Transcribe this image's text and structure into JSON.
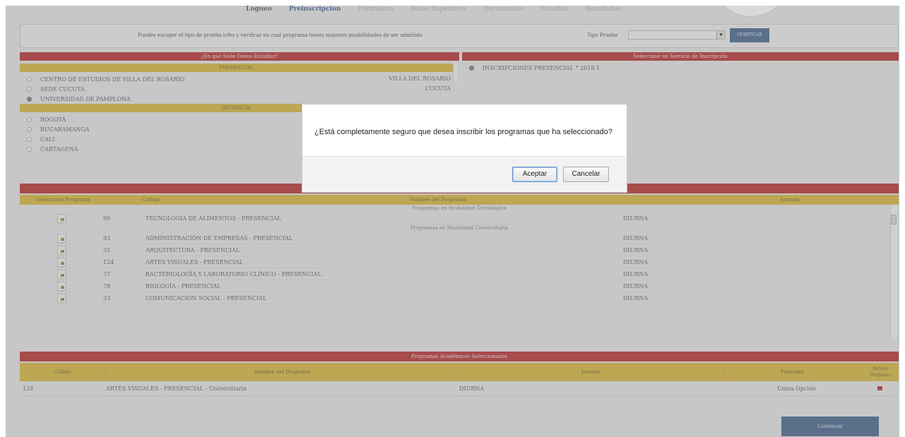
{
  "nav": {
    "tabs": [
      {
        "label": "Logueo",
        "state": "dark"
      },
      {
        "label": "Preinscripcion",
        "state": "active"
      },
      {
        "label": "Formulario",
        "state": "muted"
      },
      {
        "label": "Datos Superiores",
        "state": "muted"
      },
      {
        "label": "Documentos",
        "state": "muted"
      },
      {
        "label": "Estudios",
        "state": "muted"
      },
      {
        "label": "Resultados",
        "state": "muted"
      }
    ]
  },
  "instruction": {
    "text": "Puedes escoger el tipo de prueba icfes y verificar en cual programa tienes mayores posibilidades de ser admitido",
    "tipo_label": "Tipo Prueba",
    "tipo_value": "",
    "verify_label": "VERIFICAR"
  },
  "study_place": {
    "title": "¿En qué Sede Desea Estudiar?",
    "presencial_label": "PRESENCIAL",
    "presencial": [
      {
        "name": "CENTRO DE ESTUDIOS DE VILLA DEL ROSARIO",
        "city": "VILLA DEL ROSARIO",
        "selected": false
      },
      {
        "name": "SEDE CUCUTA",
        "city": "CUCUTA",
        "selected": false
      },
      {
        "name": "UNIVERSIDAD DE PAMPLONA",
        "city": "",
        "selected": true
      }
    ],
    "distancia_label": "DISTANCIA",
    "distancia": [
      {
        "name": "BOGOTÁ",
        "selected": false
      },
      {
        "name": "BUCARAMANGA",
        "selected": false
      },
      {
        "name": "CALI",
        "selected": false
      },
      {
        "name": "CARTAGENA",
        "selected": false
      }
    ]
  },
  "service": {
    "title": "Seleccione un Servicio de Inscripción",
    "option": "INSCRIPCIONES PRESENCIAL * 2018-1"
  },
  "programs": {
    "columns": [
      "Seleccione Programa",
      "Código",
      "Nombre del Programa",
      "Jornada"
    ],
    "group_tecnologica": "Programas en Modalidad Tecnológica",
    "group_universitaria": "Programas en Modalidad Universitaria",
    "tecnologica_rows": [
      {
        "code": "90",
        "name": "TECNOLOGÍA DE ALIMENTOS - PRESENCIAL",
        "jornada": "DIURNA"
      }
    ],
    "universitaria_rows": [
      {
        "code": "93",
        "name": "ADMINISTRACIÓN DE EMPRESAS - PRESENCIAL",
        "jornada": "DIURNA"
      },
      {
        "code": "35",
        "name": "ARQUITECTURA - PRESENCIAL",
        "jornada": "DIURNA"
      },
      {
        "code": "124",
        "name": "ARTES VISUALES - PRESENCIAL",
        "jornada": "DIURNA"
      },
      {
        "code": "77",
        "name": "BACTERIOLOGÍA Y LABORATORIO CLÍNICO - PRESENCIAL",
        "jornada": "DIURNA"
      },
      {
        "code": "78",
        "name": "BIOLOGÍA - PRESENCIAL",
        "jornada": "DIURNA"
      },
      {
        "code": "33",
        "name": "COMUNICACIÓN SOCIAL - PRESENCIAL",
        "jornada": "DIURNA"
      }
    ]
  },
  "selected_programs": {
    "title": "Programas Académicos Seleccionados",
    "columns": [
      "Código",
      "Nombre del Programa",
      "Jornada",
      "Prioridad",
      "Retirar Programa"
    ],
    "rows": [
      {
        "code": "124",
        "name": "ARTES VISUALES - PRESENCIAL - Universitaria",
        "jornada": "DIURNA",
        "priority": "Única Opción"
      }
    ]
  },
  "continue_label": "Continuar",
  "dialog": {
    "message": "¿Está completamente seguro que desea inscribir los programas que ha seleccionado?",
    "accept": "Aceptar",
    "cancel": "Cancelar"
  }
}
